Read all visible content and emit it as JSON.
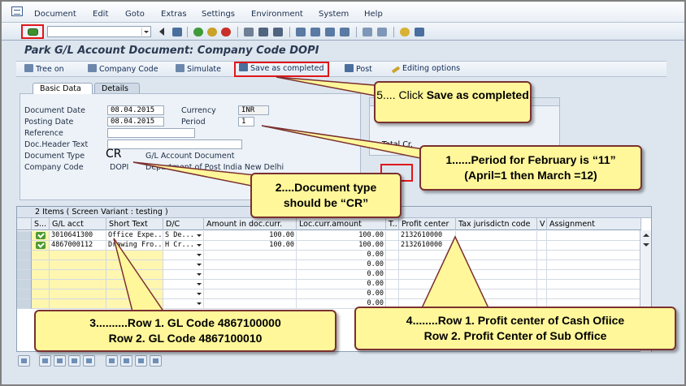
{
  "menu": {
    "items": [
      "Document",
      "Edit",
      "Goto",
      "Extras",
      "Settings",
      "Environment",
      "System",
      "Help"
    ]
  },
  "toolbar": {
    "command_value": ""
  },
  "page_title": "Park G/L Account Document: Company Code DOPI",
  "app_toolbar": {
    "tree_on": "Tree on",
    "company_code": "Company Code",
    "simulate": "Simulate",
    "save_as_completed": "Save as completed",
    "post": "Post",
    "editing_options": "Editing options"
  },
  "tabs": {
    "basic_data": "Basic Data",
    "details": "Details"
  },
  "form": {
    "document_date_label": "Document Date",
    "document_date_value": "08.04.2015",
    "currency_label": "Currency",
    "currency_value": "INR",
    "posting_date_label": "Posting Date",
    "posting_date_value": "08.04.2015",
    "period_label": "Period",
    "period_value": "1",
    "reference_label": "Reference",
    "doc_header_text_label": "Doc.Header Text",
    "document_type_label": "Document Type",
    "document_type_value": "CR",
    "document_type_desc": "G/L Account Document",
    "company_code_label": "Company Code",
    "company_code_value": "DOPI",
    "company_code_desc": "Department of Post India New Delhi"
  },
  "right_panel": {
    "total_cr_label": "Total Cr."
  },
  "grid": {
    "title": "2 Items ( Screen Variant : testing )",
    "headers": [
      "S...",
      "G/L acct",
      "Short Text",
      "D/C",
      "Amount in doc.curr.",
      "Loc.curr.amount",
      "T..",
      "Profit center",
      "Tax jurisdictn code",
      "V",
      "Assignment"
    ],
    "rows": [
      {
        "gl": "3010641300",
        "short_text": "Office Expe...",
        "dc": "S De...",
        "amount": "100.00",
        "loc_amount": "100.00",
        "profit_center": "2132610000"
      },
      {
        "gl": "4867000112",
        "short_text": "Drawing Fro...",
        "dc": "H Cr...",
        "amount": "100.00",
        "loc_amount": "100.00",
        "profit_center": "2132610000"
      },
      {
        "loc_amount": "0.00"
      },
      {
        "loc_amount": "0.00"
      },
      {
        "loc_amount": "0.00"
      },
      {
        "loc_amount": "0.00"
      },
      {
        "loc_amount": "0.00"
      },
      {
        "loc_amount": "0.00"
      }
    ]
  },
  "callouts": {
    "c5_prefix": "5.... Click ",
    "c5_bold": "Save as completed",
    "c1_line1": "1......Period  for February is “11”",
    "c1_line2": "(April=1 then March =12)",
    "c2_line1": "2....Document type",
    "c2_line2": "should be “CR”",
    "c3_line1": "3..........Row 1.     GL Code 4867100000",
    "c3_line2": "Row 2.  GL Code  4867100010",
    "c4_line1": "4........Row 1.      Profit center of Cash Ofiice",
    "c4_line2": "Row 2.  Profit Center of Sub Office"
  }
}
